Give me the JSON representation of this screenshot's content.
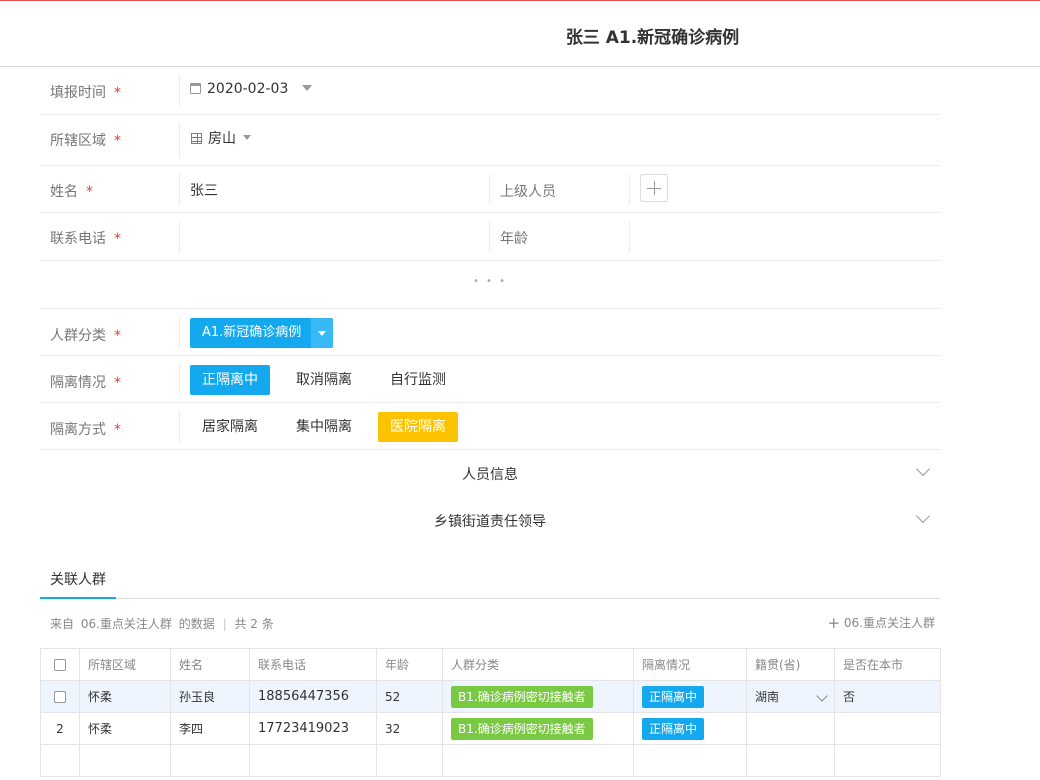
{
  "header": {
    "title": "张三 A1.新冠确诊病例"
  },
  "form": {
    "report_time": {
      "label": "填报时间",
      "required": "*",
      "value": "2020-02-03"
    },
    "district": {
      "label": "所辖区域",
      "required": "*",
      "value": "房山"
    },
    "name": {
      "label": "姓名",
      "required": "*",
      "value": "张三"
    },
    "superior": {
      "label": "上级人员"
    },
    "phone": {
      "label": "联系电话",
      "required": "*",
      "value": ""
    },
    "age": {
      "label": "年龄",
      "value": ""
    },
    "more": "• • •",
    "group": {
      "label": "人群分类",
      "required": "*",
      "value": "A1.新冠确诊病例"
    },
    "isolation_status": {
      "label": "隔离情况",
      "required": "*",
      "options": [
        "正隔离中",
        "取消隔离",
        "自行监测"
      ],
      "selected": "正隔离中"
    },
    "isolation_method": {
      "label": "隔离方式",
      "required": "*",
      "options": [
        "居家隔离",
        "集中隔离",
        "医院隔离"
      ],
      "selected": "医院隔离"
    }
  },
  "sections": [
    {
      "title": "人员信息"
    },
    {
      "title": "乡镇街道责任领导"
    }
  ],
  "related": {
    "tab": "关联人群",
    "source_prefix": "来自",
    "source_name": "06.重点关注人群",
    "source_suffix": "的数据",
    "count_text": "共 2 条",
    "add_label": "06.重点关注人群",
    "columns": [
      "所辖区域",
      "姓名",
      "联系电话",
      "年龄",
      "人群分类",
      "隔离情况",
      "籍贯(省)",
      "是否在本市"
    ],
    "rows": [
      {
        "index": "",
        "district": "怀柔",
        "name": "孙玉良",
        "phone": "18856447356",
        "age": "52",
        "group": "B1.确诊病例密切接触者",
        "status": "正隔离中",
        "province": "湖南",
        "in_city": "否"
      },
      {
        "index": "2",
        "district": "怀柔",
        "name": "李四",
        "phone": "17723419023",
        "age": "32",
        "group": "B1.确诊病例密切接触者",
        "status": "正隔离中",
        "province": "",
        "in_city": ""
      }
    ]
  },
  "colors": {
    "accent": "#14a9ef",
    "yellow": "#fcc400",
    "green": "#7ac943",
    "required": "#e0413a"
  }
}
